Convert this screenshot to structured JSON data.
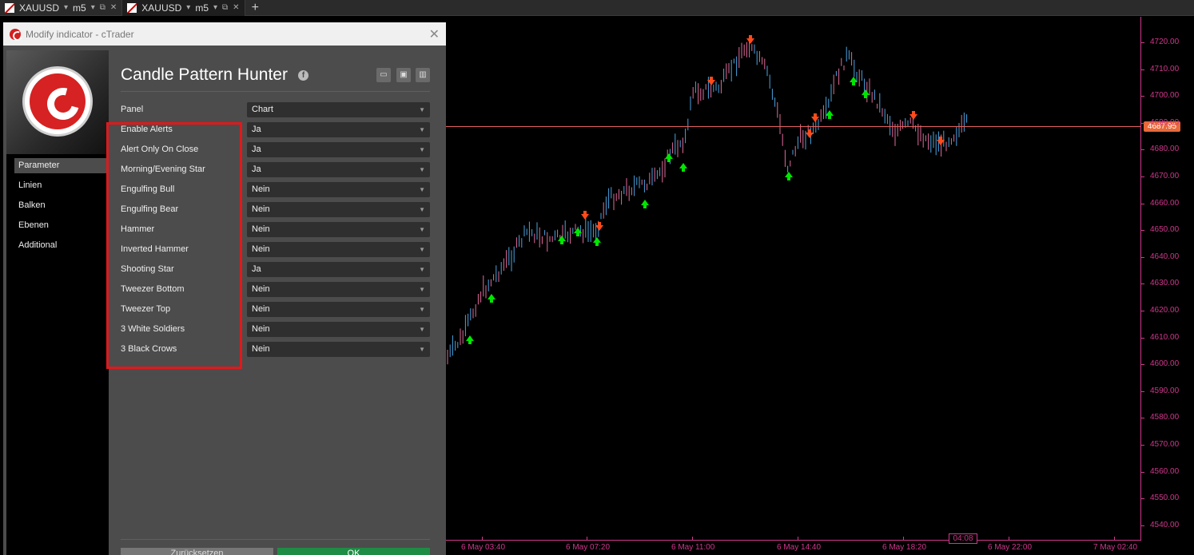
{
  "tabs": [
    {
      "symbol": "XAUUSD",
      "timeframe": "m5",
      "active": false
    },
    {
      "symbol": "XAUUSD",
      "timeframe": "m5",
      "active": true
    }
  ],
  "dialog": {
    "window_title": "Modify indicator - cTrader",
    "indicator_name": "Candle Pattern Hunter",
    "nav": [
      "Parameter",
      "Linien",
      "Balken",
      "Ebenen",
      "Additional"
    ],
    "nav_active": "Parameter",
    "params": [
      {
        "label": "Panel",
        "value": "Chart"
      },
      {
        "label": "Enable Alerts",
        "value": "Ja"
      },
      {
        "label": "Alert Only On Close",
        "value": "Ja"
      },
      {
        "label": "Morning/Evening Star",
        "value": "Ja"
      },
      {
        "label": "Engulfing Bull",
        "value": "Nein"
      },
      {
        "label": "Engulfing Bear",
        "value": "Nein"
      },
      {
        "label": "Hammer",
        "value": "Nein"
      },
      {
        "label": "Inverted Hammer",
        "value": "Nein"
      },
      {
        "label": "Shooting Star",
        "value": "Ja"
      },
      {
        "label": "Tweezer Bottom",
        "value": "Nein"
      },
      {
        "label": "Tweezer Top",
        "value": "Nein"
      },
      {
        "label": "3 White Soldiers",
        "value": "Nein"
      },
      {
        "label": "3 Black Crows",
        "value": "Nein"
      }
    ],
    "reset_label": "Zurücksetzen",
    "ok_label": "OK"
  },
  "chart": {
    "current_price": "4687.95",
    "time_badge": "04:08",
    "price_ticks": [
      "4720.00",
      "4710.00",
      "4700.00",
      "4690.00",
      "4680.00",
      "4670.00",
      "4660.00",
      "4650.00",
      "4640.00",
      "4630.00",
      "4620.00",
      "4610.00",
      "4600.00",
      "4590.00",
      "4580.00",
      "4570.00",
      "4560.00",
      "4550.00",
      "4540.00"
    ],
    "time_ticks": [
      "6 May 03:40",
      "6 May 07:20",
      "6 May 11:00",
      "6 May 14:40",
      "6 May 18:20",
      "6 May 22:00",
      "7 May 02:40"
    ],
    "colors": {
      "axis": "#d0378c",
      "bull": "#4aa3df",
      "bear": "#e06a9a",
      "signal_up": "#00e600",
      "signal_down": "#ff4a1a",
      "price_line": "#e5605c"
    }
  }
}
